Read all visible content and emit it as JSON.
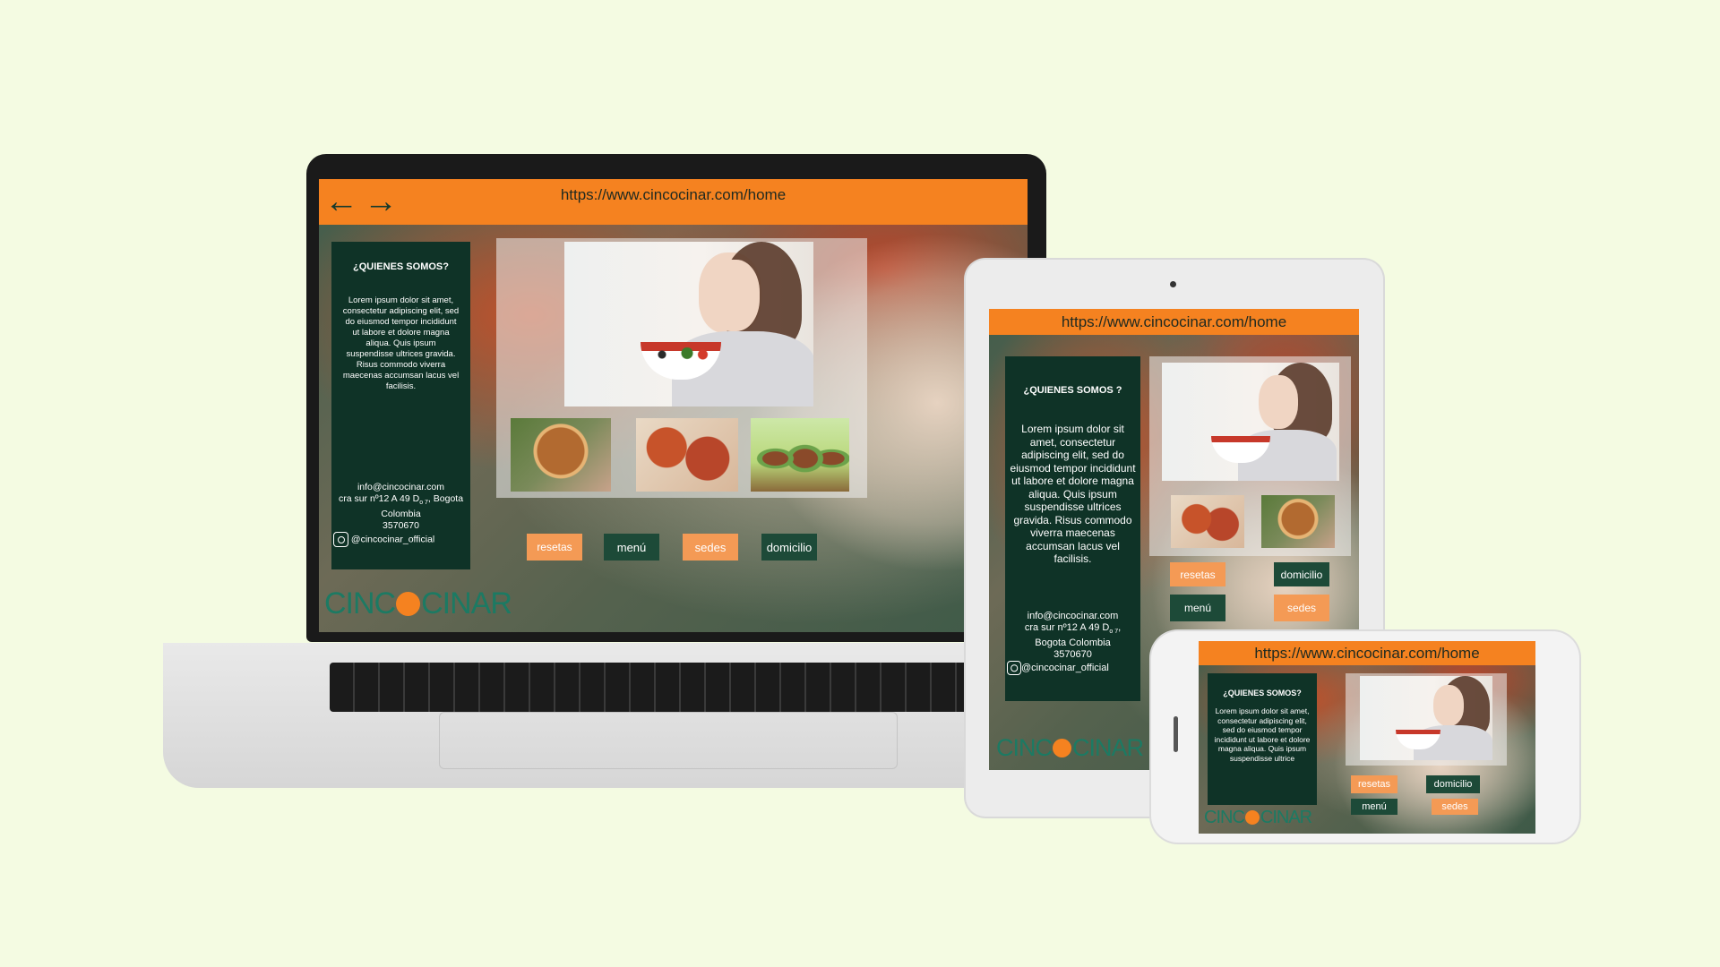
{
  "url": "https://www.cincocinar.com/home",
  "colors": {
    "background": "#f4fbe2",
    "url_bar": "#f58220",
    "panel": "#0f3327",
    "button_orange": "#f49a55",
    "button_green": "#1d4a38",
    "logo_green": "#1c7a63"
  },
  "nav_icons": [
    "arrow-left-icon",
    "arrow-right-icon"
  ],
  "about": {
    "title_desktop": "¿QUIENES SOMOS?",
    "title_tablet": "¿QUIENES SOMOS ?",
    "title_phone": "¿QUIENES SOMOS?",
    "body": "Lorem ipsum dolor sit amet, consectetur adipiscing elit, sed do eiusmod tempor incididunt ut labore et dolore magna aliqua. Quis ipsum suspendisse ultrices gravida. Risus commodo viverra maecenas accumsan lacus vel facilisis.",
    "body_phone": "Lorem ipsum dolor sit amet, consectetur adipiscing elit, sed do eiusmod tempor incididunt ut labore et dolore magna aliqua. Quis ipsum suspendisse ultrice"
  },
  "contact": {
    "email": "info@cincocinar.com",
    "address_desktop": "cra sur nº12 A 49 D",
    "address_sub": "o 7",
    "address_city_desktop": ", Bogota Colombia",
    "address_tablet": "cra sur nº12 A 49 D",
    "address_city_tablet": "Bogota Colombia",
    "phone": "3570670",
    "instagram": "@cincocinar_official"
  },
  "buttons": {
    "resetas": "resetas",
    "menu": "menú",
    "sedes": "sedes",
    "domicilio": "domicilio"
  },
  "logo": {
    "left": "CINC",
    "right": "CINAR"
  }
}
